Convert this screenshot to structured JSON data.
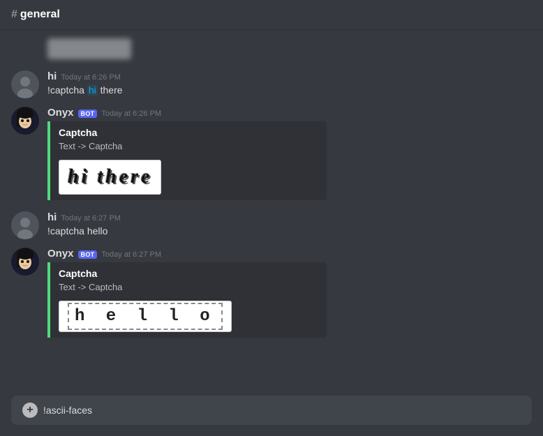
{
  "channel": {
    "name": "general",
    "hash": "#"
  },
  "messages": [
    {
      "id": "blurred-top",
      "type": "blurred"
    },
    {
      "id": "msg-1",
      "type": "user",
      "username": "hi",
      "timestamp": "Today at 6:26 PM",
      "text": "!captcha hi there",
      "highlight_word": "hi",
      "after_highlight": " there"
    },
    {
      "id": "msg-2",
      "type": "bot",
      "username": "Onyx",
      "bot_badge": "BOT",
      "timestamp": "Today at 6:26 PM",
      "embed": {
        "title": "Captcha",
        "description": "Text -> Captcha",
        "captcha_type": "hi_there",
        "captcha_display": "hi there"
      }
    },
    {
      "id": "msg-3",
      "type": "user",
      "username": "hi",
      "timestamp": "Today at 6:27 PM",
      "text": "!captcha hello",
      "highlight_word": null
    },
    {
      "id": "msg-4",
      "type": "bot",
      "username": "Onyx",
      "bot_badge": "BOT",
      "timestamp": "Today at 6:27 PM",
      "embed": {
        "title": "Captcha",
        "description": "Text -> Captcha",
        "captcha_type": "hello",
        "captcha_display": "hello"
      }
    }
  ],
  "input": {
    "placeholder": "!ascii-faces",
    "value": "!ascii-faces"
  },
  "labels": {
    "channel_prefix": "#",
    "bot_badge": "BOT"
  }
}
